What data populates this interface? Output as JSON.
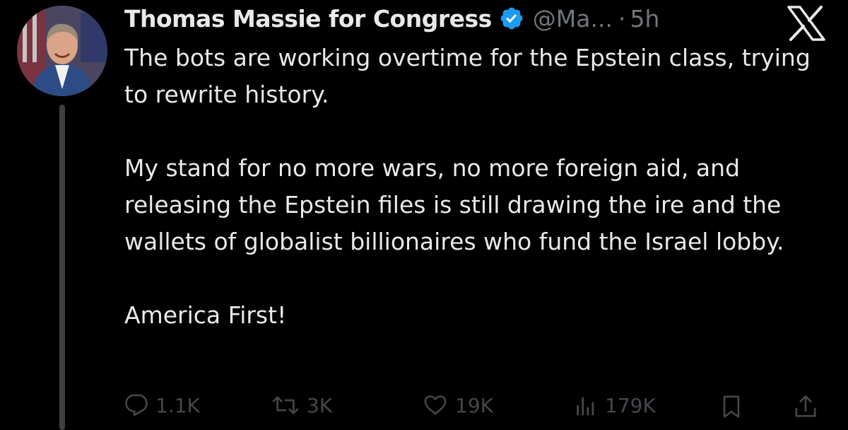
{
  "tweet": {
    "display_name": "Thomas Massie for Congress",
    "handle": "@Ma...",
    "separator": "·",
    "time": "5h",
    "paragraphs": [
      "The bots are working overtime for the Epstein class, trying to rewrite history.",
      "My stand for no more wars, no more foreign aid, and releasing the Epstein files is still drawing the ire and the wallets of globalist billionaires who fund the Israel lobby.",
      "America First!"
    ]
  },
  "actions": {
    "replies": "1.1K",
    "reposts": "3K",
    "likes": "19K",
    "views": "179K"
  },
  "icons": {
    "verified": "verified-badge-icon",
    "platform_logo": "x-logo-icon",
    "reply": "comment-bubble-icon",
    "repost": "repost-arrows-icon",
    "like": "heart-icon",
    "views": "bar-chart-icon",
    "bookmark": "bookmark-icon",
    "share": "share-upload-icon"
  },
  "colors": {
    "background": "#000000",
    "text": "#e7e9ea",
    "muted": "#71767b",
    "verified": "#1d9bf0",
    "thread_line": "#3e4144"
  }
}
